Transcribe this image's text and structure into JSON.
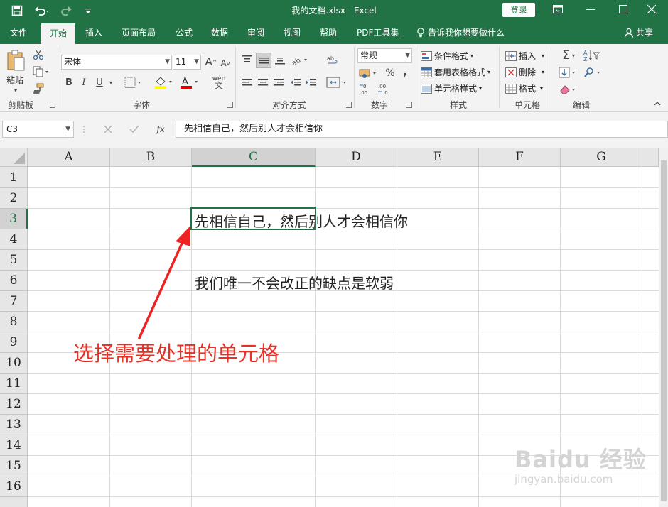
{
  "window": {
    "title": "我的文档.xlsx  -  Excel",
    "login": "登录"
  },
  "tabs": [
    "文件",
    "开始",
    "插入",
    "页面布局",
    "公式",
    "数据",
    "审阅",
    "视图",
    "帮助",
    "PDF工具集"
  ],
  "tell_me": "告诉我你想要做什么",
  "share": "共享",
  "ribbon": {
    "clipboard": {
      "paste": "粘贴",
      "label": "剪贴板"
    },
    "font": {
      "name": "宋体",
      "size": "11",
      "label": "字体",
      "bold": "B",
      "italic": "I",
      "underline": "U",
      "grow": "A",
      "shrink": "A",
      "phonetic": "wén"
    },
    "alignment": {
      "label": "对齐方式"
    },
    "number": {
      "format": "常规",
      "label": "数字",
      "percent": "%",
      "comma": ","
    },
    "styles": {
      "conditional": "条件格式",
      "table": "套用表格格式",
      "cell": "单元格样式",
      "label": "样式"
    },
    "cells": {
      "insert": "插入",
      "delete": "删除",
      "format": "格式",
      "label": "单元格"
    },
    "editing": {
      "label": "编辑",
      "sum": "Σ"
    }
  },
  "formula_bar": {
    "name_box": "C3",
    "fx": "fx",
    "content": "先相信自己，然后别人才会相信你"
  },
  "sheet": {
    "columns": [
      "A",
      "B",
      "C",
      "D",
      "E",
      "F",
      "G"
    ],
    "rows": [
      "1",
      "2",
      "3",
      "4",
      "5",
      "6",
      "7",
      "8",
      "9",
      "10",
      "11",
      "12",
      "13",
      "14",
      "15",
      "16"
    ],
    "selected_cell": "C3",
    "cells": {
      "C3": "先相信自己，然后别人才会相信你",
      "C6": "我们唯一不会改正的缺点是软弱"
    }
  },
  "annotation": {
    "text": "选择需要处理的单元格",
    "color": "#e53126"
  },
  "watermark": {
    "brand": "Baidu 经验",
    "url": "jingyan.baidu.com"
  },
  "colors": {
    "excel_green": "#217346",
    "ribbon_bg": "#f3f3f3",
    "header_bg": "#e6e6e6"
  }
}
